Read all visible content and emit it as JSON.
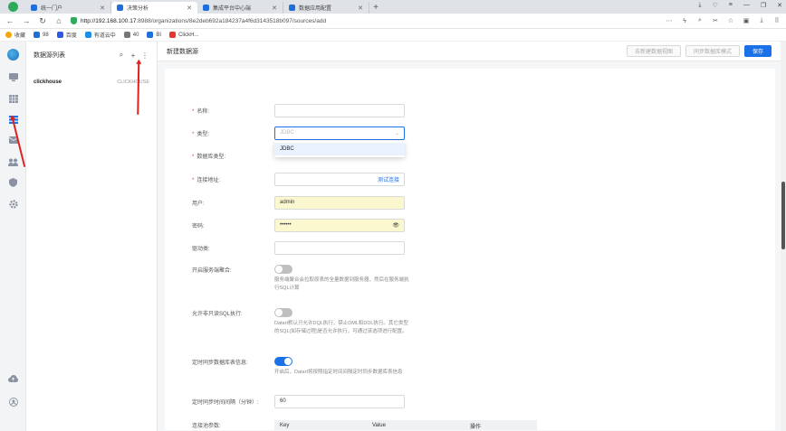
{
  "browser": {
    "tabs": [
      {
        "title": "统一门户",
        "active": false
      },
      {
        "title": "决策分析",
        "active": true
      },
      {
        "title": "集成平台中心端",
        "active": false
      },
      {
        "title": "数据应用配置",
        "active": false
      }
    ],
    "url_host": "http://192.168.100.17",
    "url_rest": ":8988/organizations/8e2deb692a184237a4f6d3143518b097/sources/add",
    "bookmarks": [
      "收藏",
      "98",
      "百度",
      "有道云中",
      "40",
      "BI",
      "ClickH..."
    ]
  },
  "app": {
    "list_title": "数据源列表",
    "sources": [
      {
        "name": "clickhouse",
        "type": "CLICKHOUSE"
      }
    ],
    "page_title": "新建数据源",
    "buttons": {
      "db_view": "去新建数据视图",
      "sync_mode": "同步数据库模式",
      "save": "保存"
    },
    "form": {
      "name_label": "名称:",
      "type_label": "类型:",
      "type_value": "JDBC",
      "type_option": "JDBC",
      "dbtype_label": "数据库类型:",
      "conn_label": "连接地址:",
      "test_conn": "测试连接",
      "user_label": "用户:",
      "user_value": "admin",
      "pwd_label": "密码:",
      "pwd_value": "••••••",
      "driver_label": "驱动类:",
      "server_agg_label": "开启服务端聚合:",
      "server_agg_help": "服务端聚合会拉取原表的全量数据到服务器，然后在服务端执行SQL计算",
      "allow_sql_label": "允许非只读SQL执行:",
      "allow_sql_help": "Datart默认只允许DQL执行，禁止DML和DDL执行。其它类型的SQL(如存储过程)是否允许执行，可通过该选项进行配置。",
      "sync_label": "定时同步数据库表信息:",
      "sync_help": "开启后，Datart将按照指定时间间隔定时同步数据库表信息",
      "interval_label": "定时同步时间间隔（分钟）:",
      "interval_value": "60",
      "params_label": "连接池参数:",
      "params_cols": [
        "Key",
        "Value",
        "操作"
      ]
    }
  },
  "colors": {
    "accent": "#1b72e8",
    "required": "#e8362c",
    "annotation": "#e02020"
  }
}
